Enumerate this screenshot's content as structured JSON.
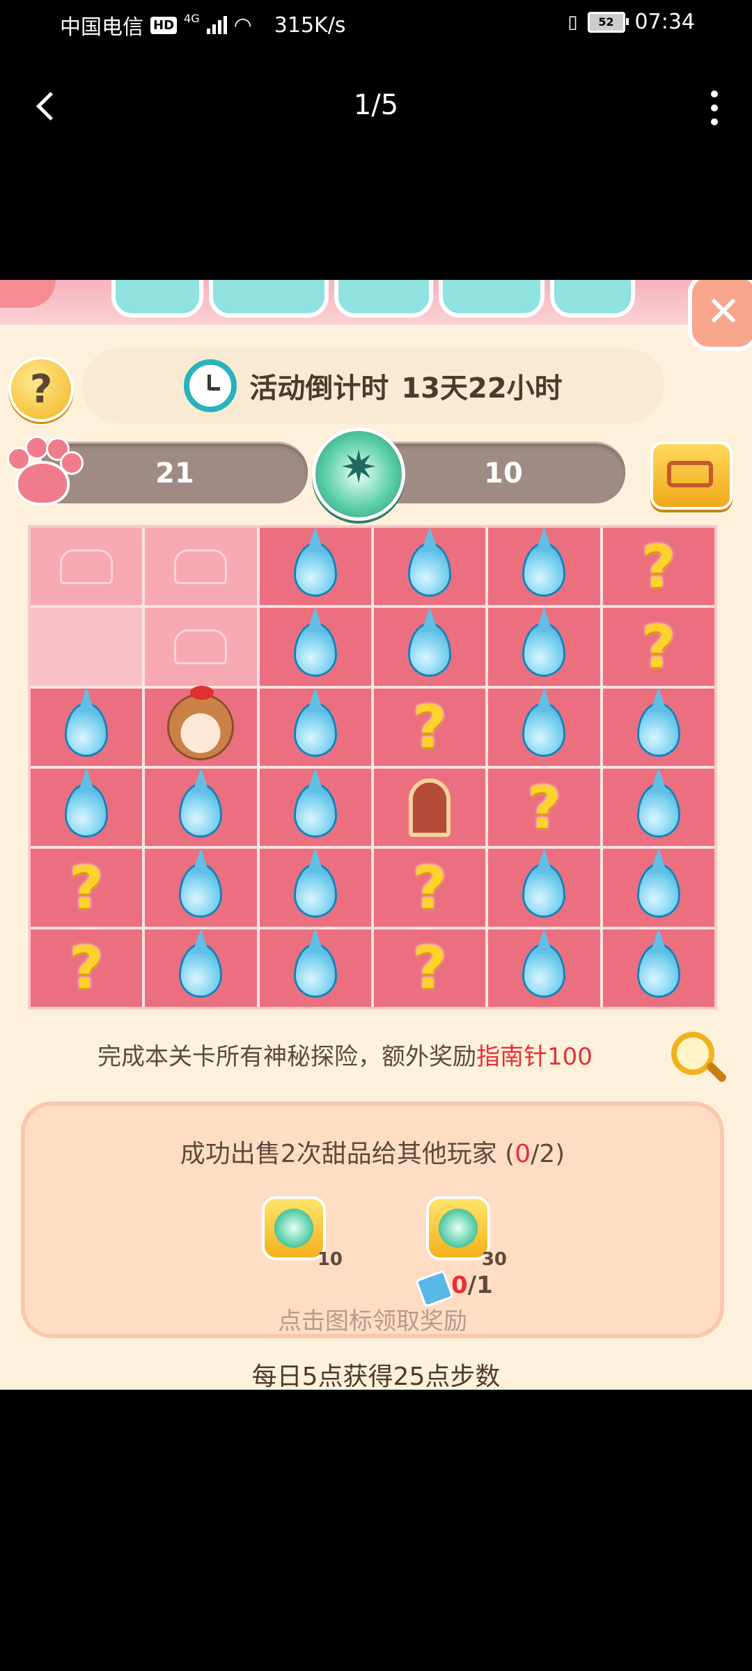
{
  "status_bar": {
    "carrier": "中国电信",
    "hd": "HD",
    "network": "4G",
    "speed": "315K/s",
    "battery": "52",
    "time": "07:34"
  },
  "nav": {
    "pager": "1/5"
  },
  "game": {
    "countdown_label": "活动倒计时",
    "countdown_value": "13天22小时",
    "steps_count": "21",
    "compass_count": "10",
    "grid": [
      [
        "explored",
        "explored",
        "drop",
        "drop",
        "drop",
        "question"
      ],
      [
        "explored-light",
        "explored",
        "drop",
        "drop",
        "drop",
        "question"
      ],
      [
        "drop",
        "girl",
        "drop",
        "question",
        "drop",
        "drop"
      ],
      [
        "drop",
        "drop",
        "drop",
        "door",
        "question",
        "drop"
      ],
      [
        "question",
        "drop",
        "drop",
        "question",
        "drop",
        "drop"
      ],
      [
        "question",
        "drop",
        "drop",
        "question",
        "drop",
        "drop"
      ]
    ],
    "tip_prefix": "完成本关卡所有神秘探险，额外奖励",
    "tip_highlight": "指南针100",
    "task": {
      "title_prefix": "成功出售2次甜品给其他玩家 (",
      "progress_current": "0",
      "title_suffix": "/2)",
      "reward1_amount": "10",
      "reward2_amount": "30",
      "ticket_current": "0",
      "ticket_total": "/1",
      "claim_hint": "点击图标领取奖励"
    },
    "bottom_text": "每日5点获得25点步数"
  },
  "colors": {
    "cell": "#ec6f7f",
    "explored_cell": "#f7a9b2",
    "highlight_red": "#ea2d35",
    "panel": "#ffddc5"
  }
}
